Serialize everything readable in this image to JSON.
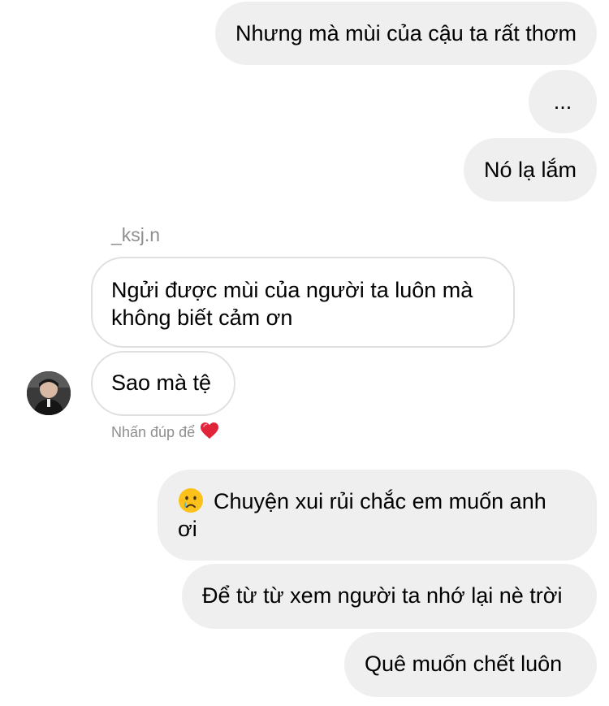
{
  "messages_top": [
    {
      "text": "Nhưng mà mùi của cậu ta rất thơm"
    },
    {
      "text": "..."
    },
    {
      "text": "Nó lạ lắm"
    }
  ],
  "sender": {
    "username": "_ksj.n"
  },
  "messages_incoming": [
    {
      "line1": "Ngửi được mùi của người ta luôn mà",
      "line2": "không biết cảm ơn"
    },
    {
      "text": "Sao mà tệ"
    }
  ],
  "double_tap_hint": {
    "text": "Nhấn đúp để",
    "icon": "heart-icon",
    "icon_color": "#e0243a"
  },
  "messages_bottom": [
    {
      "emoji": "crying-face-icon",
      "line1": "Chuyện xui rủi chắc em muốn anh",
      "line2": "ơi"
    },
    {
      "text": "Để từ từ xem người ta nhớ lại nè trời"
    },
    {
      "text": "Quê muốn chết luôn"
    }
  ],
  "colors": {
    "outgoing_bubble": "#efefef",
    "incoming_border": "#e0e0e0",
    "meta_text": "#8e8e8e"
  }
}
